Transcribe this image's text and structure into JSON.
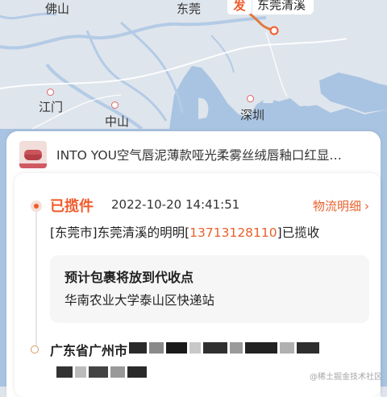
{
  "map": {
    "cities": [
      "佛山",
      "东莞",
      "江门",
      "中山",
      "深圳"
    ],
    "origin_marker": "发",
    "current_location_label": "东莞清溪"
  },
  "product": {
    "title": "INTO YOU空气唇泥薄款哑光柔雾丝绒唇釉口红显…",
    "thumbnail_icon": "lip-product-thumbnail"
  },
  "timeline": {
    "current": {
      "status": "已揽件",
      "time": "2022-10-20 14:41:51",
      "detail_link": "物流明细",
      "event_prefix": "[东莞市]东莞清溪的明明[",
      "event_phone": "13713128110",
      "event_suffix": "]已揽收"
    },
    "info": {
      "title": "预计包裹将放到代收点",
      "station": "华南农业大学泰山区快递站"
    },
    "previous": {
      "partial_text": "广东省广州市"
    }
  },
  "watermark": "@稀土掘金技术社区",
  "colors": {
    "accent": "#f25a2a",
    "map_water": "#a9c4e2",
    "map_land": "#dfe5ec"
  }
}
